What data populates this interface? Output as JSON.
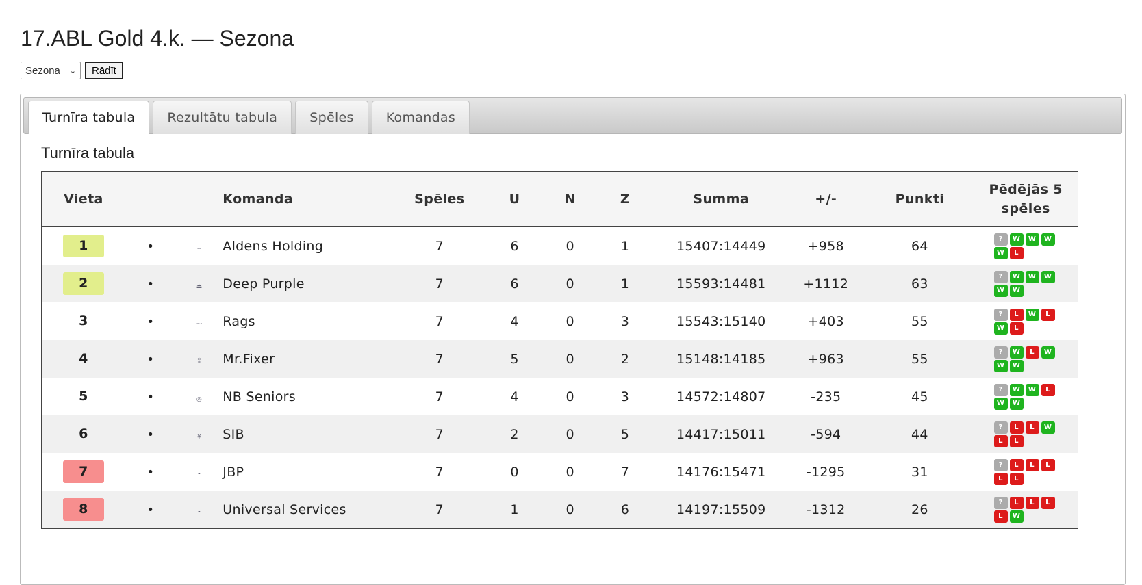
{
  "page": {
    "title": "17.ABL Gold 4.k. — Sezona"
  },
  "season_form": {
    "selected": "Sezona",
    "button_label": "Rādīt"
  },
  "tabs": [
    {
      "label": "Turnīra tabula",
      "active": true
    },
    {
      "label": "Rezultātu tabula",
      "active": false
    },
    {
      "label": "Spēles",
      "active": false
    },
    {
      "label": "Komandas",
      "active": false
    }
  ],
  "section_title": "Turnīra tabula",
  "table": {
    "headers": {
      "place": "Vieta",
      "team": "Komanda",
      "games": "Spēles",
      "wins": "U",
      "draws": "N",
      "losses": "Z",
      "score": "Summa",
      "diff": "+/-",
      "points": "Punkti",
      "last5": "Pēdējās 5 spēles"
    },
    "rows": [
      {
        "place": "1",
        "zone": "top",
        "bullet": "•",
        "logo": "╍",
        "team": "Aldens Holding",
        "games": "7",
        "wins": "6",
        "draws": "0",
        "losses": "1",
        "score": "15407:14449",
        "diff": "+958",
        "points": "64",
        "last5": [
          "?",
          "W",
          "W",
          "W",
          "W",
          "L"
        ]
      },
      {
        "place": "2",
        "zone": "top",
        "bullet": "•",
        "logo": "⏏",
        "team": "Deep Purple",
        "games": "7",
        "wins": "6",
        "draws": "0",
        "losses": "1",
        "score": "15593:14481",
        "diff": "+1112",
        "points": "63",
        "last5": [
          "?",
          "W",
          "W",
          "W",
          "W",
          "W"
        ]
      },
      {
        "place": "3",
        "zone": "",
        "bullet": "•",
        "logo": "⁓",
        "team": "Rags",
        "games": "7",
        "wins": "4",
        "draws": "0",
        "losses": "3",
        "score": "15543:15140",
        "diff": "+403",
        "points": "55",
        "last5": [
          "?",
          "L",
          "W",
          "L",
          "W",
          "L"
        ]
      },
      {
        "place": "4",
        "zone": "",
        "bullet": "•",
        "logo": "⁑",
        "team": "Mr.Fixer",
        "games": "7",
        "wins": "5",
        "draws": "0",
        "losses": "2",
        "score": "15148:14185",
        "diff": "+963",
        "points": "55",
        "last5": [
          "?",
          "W",
          "L",
          "W",
          "W",
          "W"
        ]
      },
      {
        "place": "5",
        "zone": "",
        "bullet": "•",
        "logo": "◎",
        "team": "NB Seniors",
        "games": "7",
        "wins": "4",
        "draws": "0",
        "losses": "3",
        "score": "14572:14807",
        "diff": "-235",
        "points": "45",
        "last5": [
          "?",
          "W",
          "W",
          "L",
          "W",
          "W"
        ]
      },
      {
        "place": "6",
        "zone": "",
        "bullet": "•",
        "logo": "¥",
        "team": "SIB",
        "games": "7",
        "wins": "2",
        "draws": "0",
        "losses": "5",
        "score": "14417:15011",
        "diff": "-594",
        "points": "44",
        "last5": [
          "?",
          "L",
          "L",
          "W",
          "L",
          "L"
        ]
      },
      {
        "place": "7",
        "zone": "bottom",
        "bullet": "•",
        "logo": "⁃",
        "team": "JBP",
        "games": "7",
        "wins": "0",
        "draws": "0",
        "losses": "7",
        "score": "14176:15471",
        "diff": "-1295",
        "points": "31",
        "last5": [
          "?",
          "L",
          "L",
          "L",
          "L",
          "L"
        ]
      },
      {
        "place": "8",
        "zone": "bottom",
        "bullet": "•",
        "logo": "⁃",
        "team": "Universal Services",
        "games": "7",
        "wins": "1",
        "draws": "0",
        "losses": "6",
        "score": "14197:15509",
        "diff": "-1312",
        "points": "26",
        "last5": [
          "?",
          "L",
          "L",
          "L",
          "L",
          "W"
        ]
      }
    ]
  },
  "colors": {
    "win": "#1fb41f",
    "loss": "#dd1b1b",
    "unknown": "#ababab",
    "top_zone": "#e2ee8c",
    "bottom_zone": "#f78e8e"
  },
  "icons": {
    "select": "chevron-down-icon",
    "team_logo": "team-logo-icon"
  }
}
